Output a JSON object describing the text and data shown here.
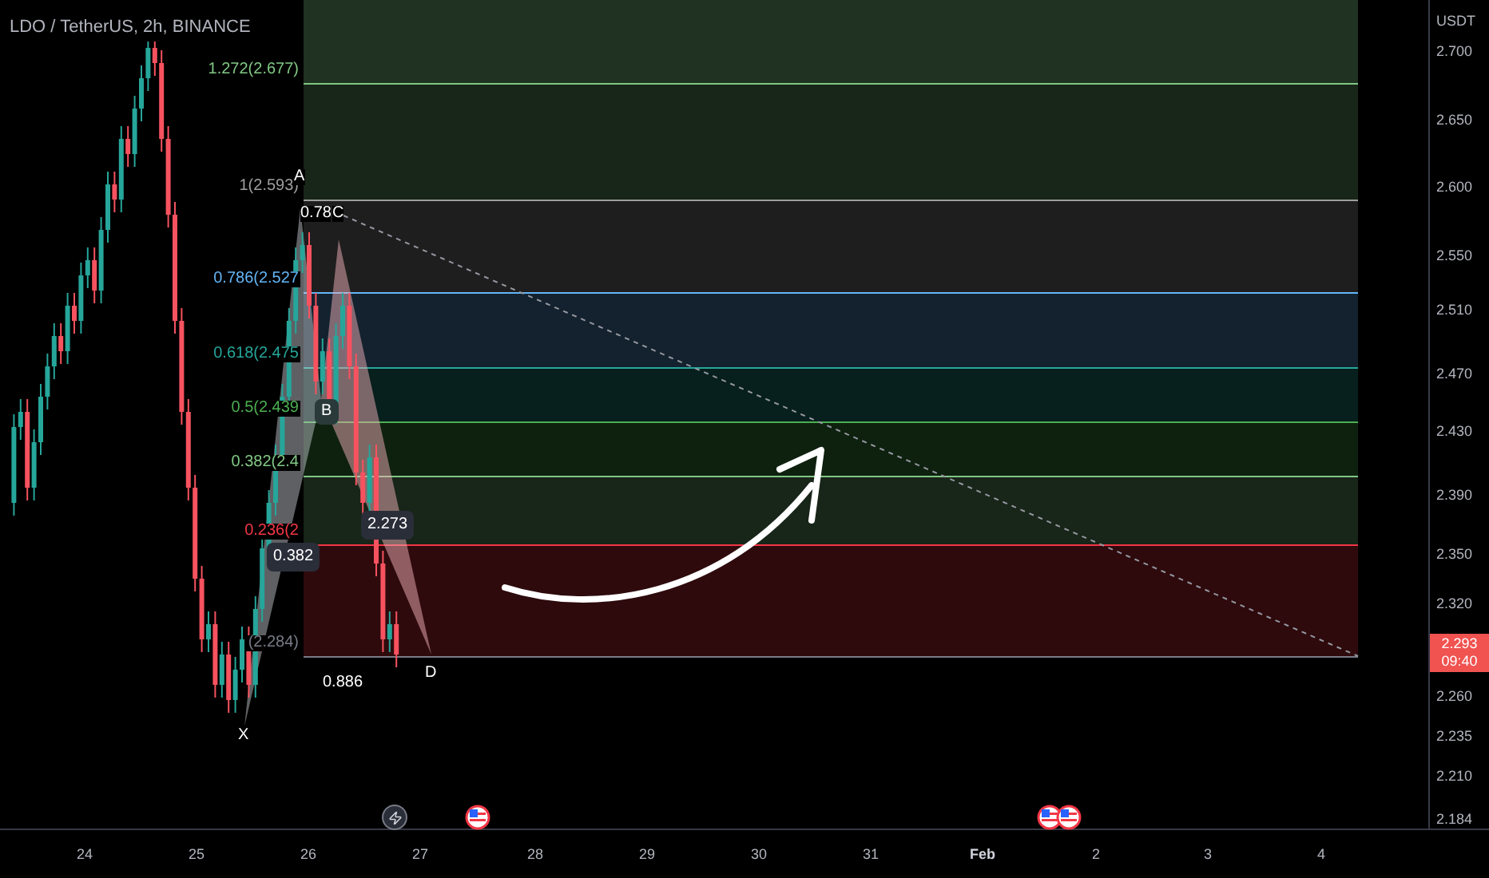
{
  "chart": {
    "title": "LDO / TetherUS, 2h, BINANCE",
    "fib_levels": [
      {
        "label": "1.272(2.677)",
        "color": "#81c784"
      },
      {
        "label": "1(2.593)",
        "color": "#9e9e9e"
      },
      {
        "label": "0.786(2.527",
        "color": "#64b5f6"
      },
      {
        "label": "0.618(2.475",
        "color": "#26a69a"
      },
      {
        "label": "0.5(2.439",
        "color": "#4caf50"
      },
      {
        "label": "0.382(2.4",
        "color": "#81c784"
      },
      {
        "label": "0.236(2",
        "color": "#f23645"
      },
      {
        "label": "(2.284)",
        "color": "#787b86"
      }
    ],
    "points": [
      {
        "label": "X"
      },
      {
        "label": "A"
      },
      {
        "label": "B",
        "kind": "badge"
      },
      {
        "label": "C"
      },
      {
        "label": "D"
      }
    ],
    "ratios": [
      {
        "label": "0.382",
        "kind": "badge"
      },
      {
        "label": "0.78",
        "kind": "plain"
      },
      {
        "label": "2.273",
        "kind": "badge"
      },
      {
        "label": "0.886",
        "kind": "plain"
      }
    ],
    "events": [
      {
        "kind": "lightning"
      },
      {
        "kind": "flag"
      },
      {
        "kind": "flag"
      },
      {
        "kind": "flag"
      }
    ]
  },
  "price_axis": {
    "unit": "USDT",
    "ticks": [
      "2.700",
      "2.650",
      "2.600",
      "2.550",
      "2.510",
      "2.470",
      "2.430",
      "2.390",
      "2.350",
      "2.320",
      "2.260",
      "2.235",
      "2.210",
      "2.184"
    ],
    "last_price": "2.293",
    "countdown": "09:40"
  },
  "time_axis": {
    "labels": [
      {
        "label": "24",
        "kind": "day"
      },
      {
        "label": "25",
        "kind": "day"
      },
      {
        "label": "26",
        "kind": "day"
      },
      {
        "label": "27",
        "kind": "day"
      },
      {
        "label": "28",
        "kind": "day"
      },
      {
        "label": "29",
        "kind": "day"
      },
      {
        "label": "30",
        "kind": "day"
      },
      {
        "label": "31",
        "kind": "day"
      },
      {
        "label": "Feb",
        "kind": "month"
      },
      {
        "label": "2",
        "kind": "day"
      },
      {
        "label": "3",
        "kind": "day"
      },
      {
        "label": "4",
        "kind": "day"
      }
    ]
  }
}
